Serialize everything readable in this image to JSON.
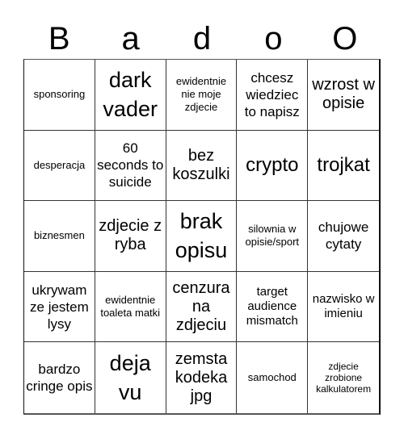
{
  "title_letters": [
    "B",
    "a",
    "d",
    "o",
    "O"
  ],
  "cells": [
    [
      "sponsoring",
      "dark vader",
      "ewidentnie nie moje zdjecie",
      "chcesz wiedziec to napisz",
      "wzrost w opisie"
    ],
    [
      "desperacja",
      "60 seconds to suicide",
      "bez koszulki",
      "crypto",
      "trojkat"
    ],
    [
      "biznesmen",
      "zdjecie z ryba",
      "brak opisu",
      "silownia w opisie/sport",
      "chujowe cytaty"
    ],
    [
      "ukrywam ze jestem lysy",
      "ewidentnie toaleta matki",
      "cenzura na zdjeciu",
      "target audience mismatch",
      "nazwisko w imieniu"
    ],
    [
      "bardzo cringe opis",
      "deja vu",
      "zemsta kodeka jpg",
      "samochod",
      "zdjecie zrobione kalkulatorem"
    ]
  ]
}
